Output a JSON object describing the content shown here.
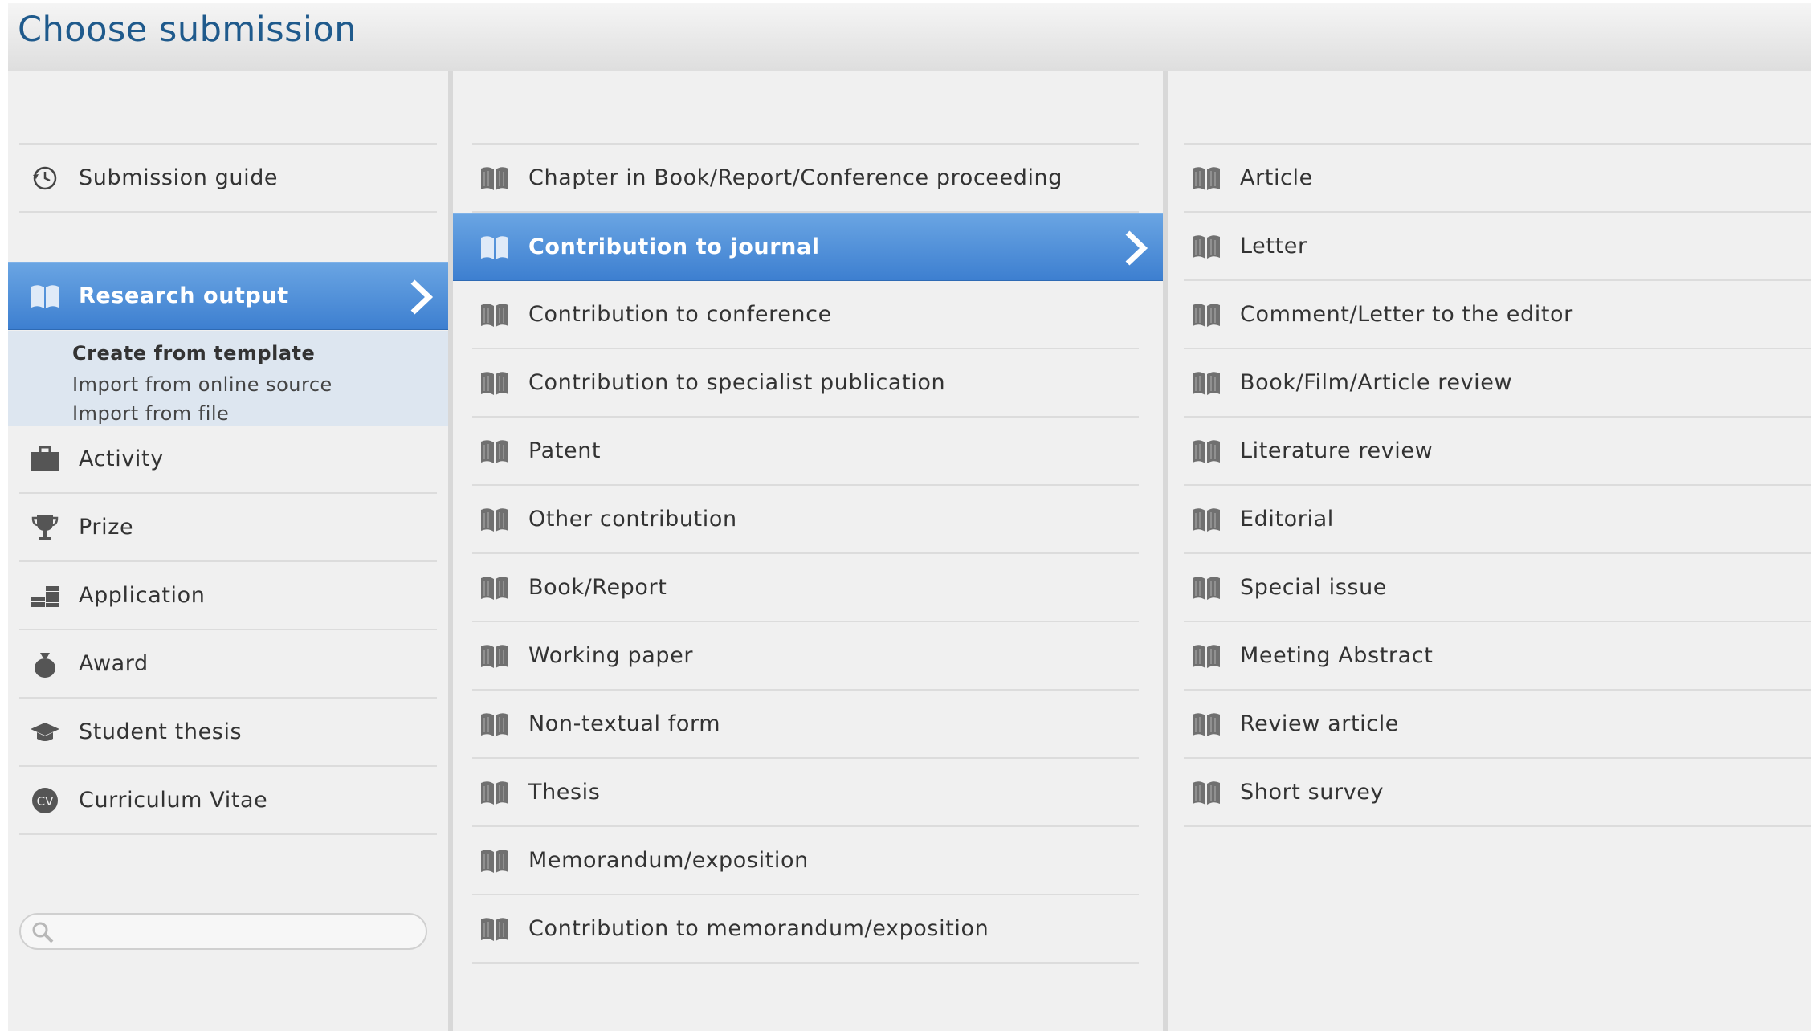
{
  "header": {
    "title": "Choose submission"
  },
  "col1": {
    "guide": {
      "label": "Submission guide",
      "icon": "clock-arrow-icon"
    },
    "selected": {
      "label": "Research output",
      "icon": "book-icon"
    },
    "subitems": [
      "Create from template",
      "Import from online source",
      "Import from file"
    ],
    "items": [
      {
        "label": "Activity",
        "icon": "briefcase-icon"
      },
      {
        "label": "Prize",
        "icon": "trophy-icon"
      },
      {
        "label": "Application",
        "icon": "money-stack-icon"
      },
      {
        "label": "Award",
        "icon": "money-bag-icon"
      },
      {
        "label": "Student thesis",
        "icon": "graduation-cap-icon"
      },
      {
        "label": "Curriculum Vitae",
        "icon": "cv-badge-icon"
      }
    ],
    "search": {
      "placeholder": "",
      "value": ""
    }
  },
  "col2": {
    "items": [
      "Chapter in Book/Report/Conference proceeding",
      "Contribution to journal",
      "Contribution to conference",
      "Contribution to specialist publication",
      "Patent",
      "Other contribution",
      "Book/Report",
      "Working paper",
      "Non-textual form",
      "Thesis",
      "Memorandum/exposition",
      "Contribution to memorandum/exposition"
    ]
  },
  "col3": {
    "items": [
      "Article",
      "Letter",
      "Comment/Letter to the editor",
      "Book/Film/Article review",
      "Literature review",
      "Editorial",
      "Special issue",
      "Meeting Abstract",
      "Review article",
      "Short survey"
    ]
  },
  "colors": {
    "title": "#1f5a8c",
    "selected_top": "#6aa5e3",
    "selected_bottom": "#3d7fd0",
    "sub_panel": "#dde6f0",
    "icon": "#6e6e6e"
  }
}
